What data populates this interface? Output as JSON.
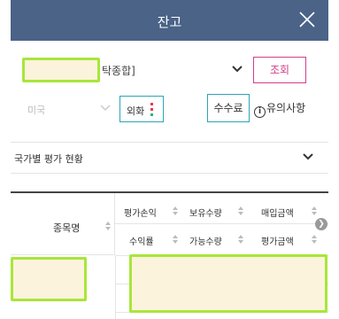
{
  "header": {
    "title": "잔고"
  },
  "account": {
    "visible_text": "탁종합]"
  },
  "search_button": "조회",
  "country": {
    "value": "미국"
  },
  "fx": {
    "label": "외화",
    "dot_colors": [
      "#e83a4a",
      "#2bb37a"
    ]
  },
  "fee_button": "수수료",
  "notice": {
    "icon": "i",
    "label": "유의사항"
  },
  "section": {
    "title": "국가별 평가 현황"
  },
  "table": {
    "name_header": "종목명",
    "headers_top": [
      "평가손익",
      "보유수량",
      "매입금액"
    ],
    "headers_bottom": [
      "수익률",
      "가능수량",
      "평가금액"
    ]
  },
  "colors": {
    "header_bg": "#4a6387",
    "accent_pink": "#d0408c",
    "accent_teal": "#2aa6b8",
    "mask_fill": "#fbf3dc",
    "mask_border": "#a8e63a"
  }
}
